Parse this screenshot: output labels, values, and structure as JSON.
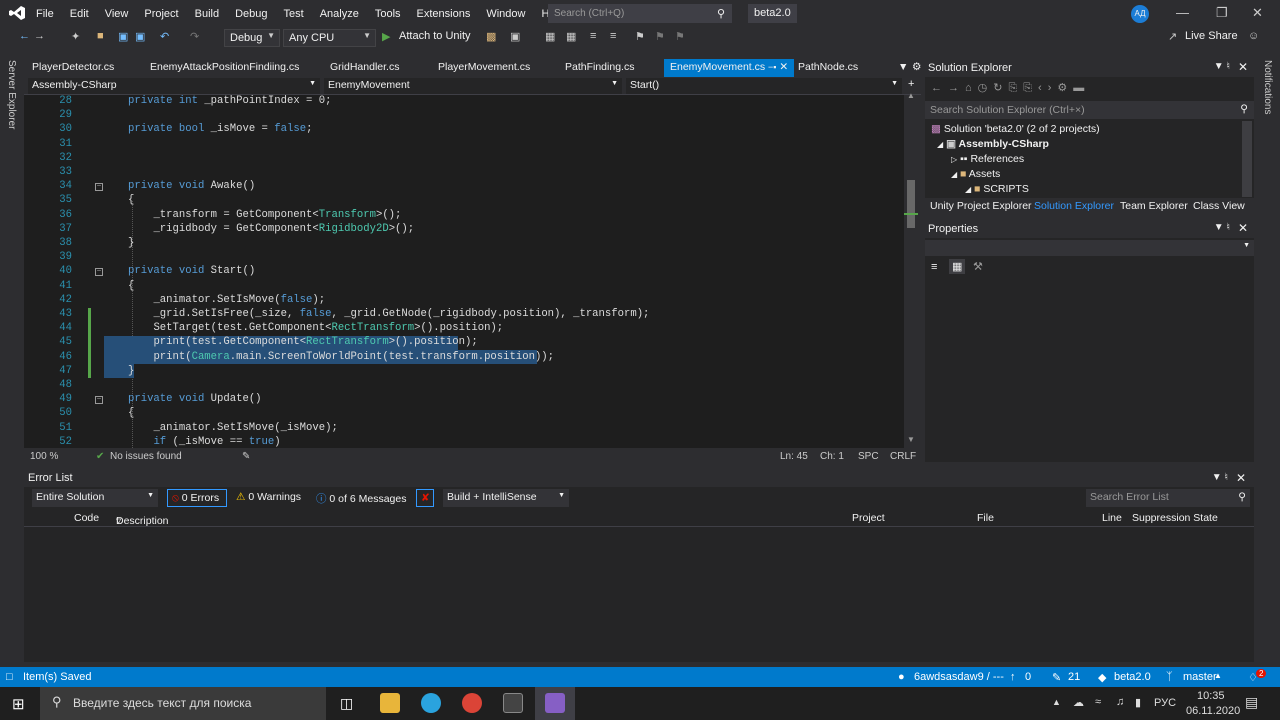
{
  "menubar": {
    "items": [
      "File",
      "Edit",
      "View",
      "Project",
      "Build",
      "Debug",
      "Test",
      "Analyze",
      "Tools",
      "Extensions",
      "Window",
      "Help"
    ],
    "search_placeholder": "Search (Ctrl+Q)",
    "solution": "beta2.0",
    "avatar": "АД"
  },
  "toolbar": {
    "config": "Debug",
    "platform": "Any CPU",
    "attach": "Attach to Unity",
    "live_share": "Live Share"
  },
  "left_strip": "Server Explorer",
  "right_strip": "Notifications",
  "tabs": [
    "PlayerDetector.cs",
    "EnemyAttackPositionFindiing.cs",
    "GridHandler.cs",
    "PlayerMovement.cs",
    "PathFinding.cs",
    "EnemyMovement.cs",
    "PathNode.cs"
  ],
  "active_tab": "EnemyMovement.cs",
  "navbar": {
    "project": "Assembly-CSharp",
    "class": "EnemyMovement",
    "member": "Start()"
  },
  "code": [
    {
      "n": "28",
      "t": "private int _pathPointIndex = 0;"
    },
    {
      "n": "29",
      "t": ""
    },
    {
      "n": "30",
      "t": "private bool _isMove = false;"
    },
    {
      "n": "31",
      "t": ""
    },
    {
      "n": "32",
      "t": ""
    },
    {
      "n": "33",
      "t": ""
    },
    {
      "n": "34",
      "t": "private void Awake()"
    },
    {
      "n": "35",
      "t": "{"
    },
    {
      "n": "36",
      "t": "    _transform = GetComponent<Transform>();"
    },
    {
      "n": "37",
      "t": "    _rigidbody = GetComponent<Rigidbody2D>();"
    },
    {
      "n": "38",
      "t": "}"
    },
    {
      "n": "39",
      "t": ""
    },
    {
      "n": "40",
      "t": "private void Start()"
    },
    {
      "n": "41",
      "t": "{"
    },
    {
      "n": "42",
      "t": "    _animator.SetIsMove(false);"
    },
    {
      "n": "43",
      "t": "    _grid.SetIsFree(_size, false, _grid.GetNode(_rigidbody.position), _transform);"
    },
    {
      "n": "44",
      "t": "    SetTarget(test.GetComponent<RectTransform>().position);"
    },
    {
      "n": "45",
      "t": "    print(test.GetComponent<RectTransform>().position);"
    },
    {
      "n": "46",
      "t": "    print(Camera.main.ScreenToWorldPoint(test.transform.position));"
    },
    {
      "n": "47",
      "t": "}"
    },
    {
      "n": "48",
      "t": ""
    },
    {
      "n": "49",
      "t": "private void Update()"
    },
    {
      "n": "50",
      "t": "{"
    },
    {
      "n": "51",
      "t": "    _animator.SetIsMove(_isMove);"
    },
    {
      "n": "52",
      "t": "    if (_isMove == true)"
    }
  ],
  "editor_status": {
    "zoom": "100 %",
    "issues": "No issues found",
    "ln": "Ln: 45",
    "ch": "Ch: 1",
    "spc": "SPC",
    "crlf": "CRLF"
  },
  "solution_explorer": {
    "title": "Solution Explorer",
    "search": "Search Solution Explorer (Ctrl+×)",
    "tree": [
      "Solution 'beta2.0' (2 of 2 projects)",
      "Assembly-CSharp",
      "References",
      "Assets",
      "SCRIPTS"
    ],
    "tabs": [
      "Unity Project Explorer",
      "Solution Explorer",
      "Team Explorer",
      "Class View"
    ]
  },
  "properties": {
    "title": "Properties"
  },
  "error_list": {
    "title": "Error List",
    "scope": "Entire Solution",
    "errors": "0 Errors",
    "warnings": "0 Warnings",
    "messages": "0 of 6 Messages",
    "build": "Build + IntelliSense",
    "search": "Search Error List",
    "columns": [
      "Code",
      "Description",
      "Project",
      "File",
      "Line",
      "Suppression State"
    ]
  },
  "statusbar": {
    "left": "Item(s) Saved",
    "repo": "6awdsasdaw9 / ---",
    "up": "0",
    "changes": "21",
    "branch_repo": "beta2.0",
    "branch": "master",
    "notif": "2"
  },
  "taskbar": {
    "search": "Введите здесь текст для поиска",
    "lang": "РУС",
    "time": "10:35",
    "date": "06.11.2020"
  },
  "colors": {
    "accent": "#007acc",
    "keyword": "#569cd6",
    "type": "#4ec9b0",
    "method": "#dcdcaa"
  }
}
